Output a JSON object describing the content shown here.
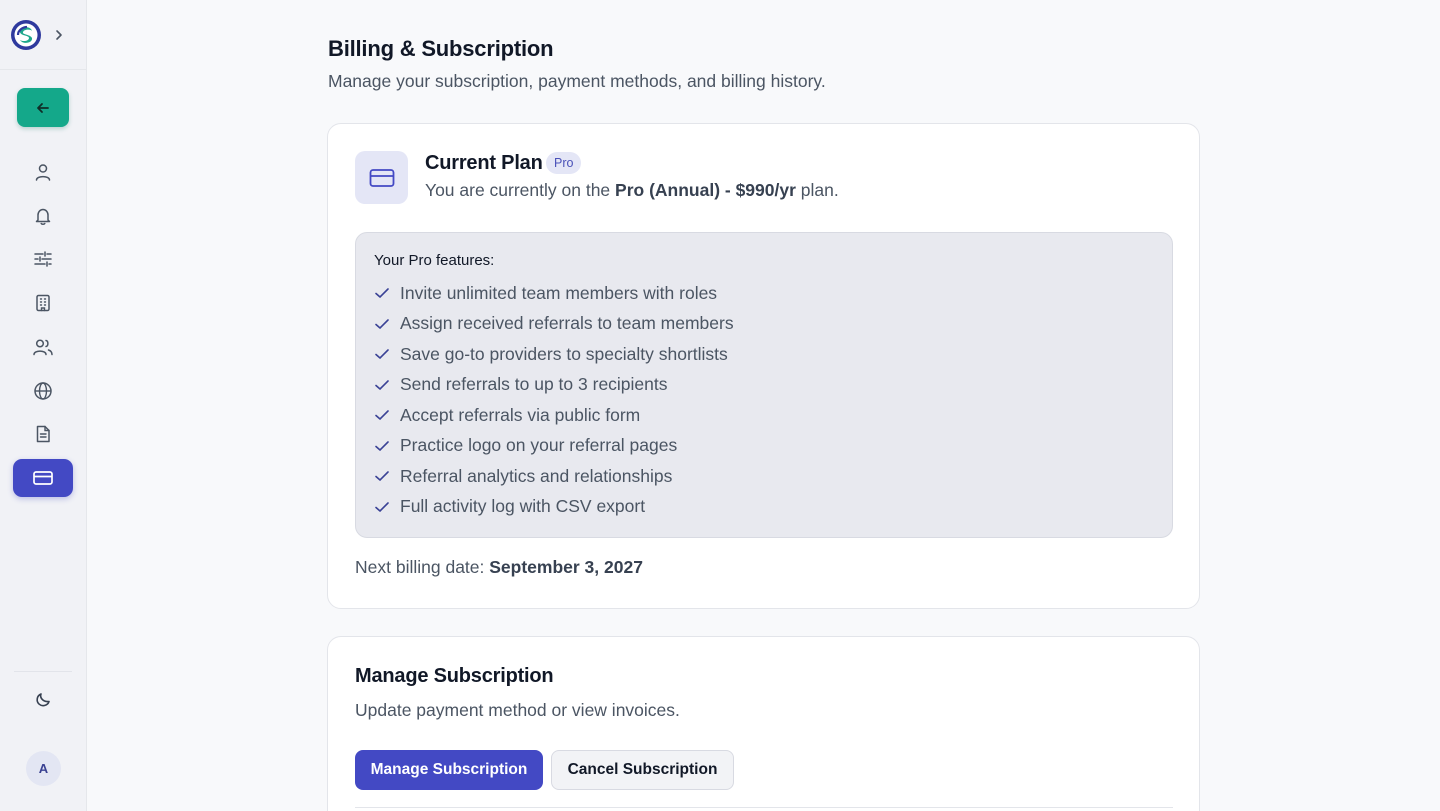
{
  "header": {
    "title": "Billing & Subscription",
    "subtitle": "Manage your subscription, payment methods, and billing history."
  },
  "sidebar": {
    "items": [
      {
        "icon": "user-icon",
        "name": "sidebar-item-profile"
      },
      {
        "icon": "bell-icon",
        "name": "sidebar-item-notifications"
      },
      {
        "icon": "sliders-icon",
        "name": "sidebar-item-preferences"
      },
      {
        "icon": "building-icon",
        "name": "sidebar-item-practice"
      },
      {
        "icon": "users-icon",
        "name": "sidebar-item-team"
      },
      {
        "icon": "globe-icon",
        "name": "sidebar-item-public"
      },
      {
        "icon": "document-icon",
        "name": "sidebar-item-documents"
      },
      {
        "icon": "credit-card-icon",
        "name": "sidebar-item-billing",
        "active": true
      }
    ],
    "avatar_initial": "A"
  },
  "current_plan": {
    "title": "Current Plan",
    "badge": "Pro",
    "desc_prefix": "You are currently on the ",
    "plan_name": "Pro (Annual) - $990/yr",
    "desc_suffix": " plan.",
    "features_title": "Your Pro features:",
    "features": [
      "Invite unlimited team members with roles",
      "Assign received referrals to team members",
      "Save go-to providers to specialty shortlists",
      "Send referrals to up to 3 recipients",
      "Accept referrals via public form",
      "Practice logo on your referral pages",
      "Referral analytics and relationships",
      "Full activity log with CSV export"
    ],
    "billing_label": "Next billing date: ",
    "billing_date": "September 3, 2027"
  },
  "manage_subscription": {
    "title": "Manage Subscription",
    "subtitle": "Update payment method or view invoices.",
    "primary_label": "Manage Subscription",
    "secondary_label": "Cancel Subscription"
  },
  "colors": {
    "accent": "#4349c4",
    "back_button": "#14a88a",
    "sidebar_bg": "#f1f2f6"
  }
}
